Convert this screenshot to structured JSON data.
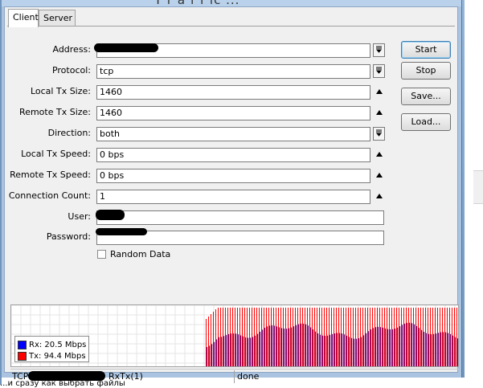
{
  "window": {
    "title_fragment": "T r a f f ic   ..."
  },
  "tabs": [
    {
      "label": "Client",
      "active": true
    },
    {
      "label": "Server",
      "active": false
    }
  ],
  "form": {
    "address": {
      "label": "Address:",
      "value": ""
    },
    "protocol": {
      "label": "Protocol:",
      "value": "tcp"
    },
    "local_tx_size": {
      "label": "Local Tx Size:",
      "value": "1460"
    },
    "remote_tx_size": {
      "label": "Remote Tx Size:",
      "value": "1460"
    },
    "direction": {
      "label": "Direction:",
      "value": "both"
    },
    "local_tx_speed": {
      "label": "Local Tx Speed:",
      "value": "0 bps"
    },
    "remote_tx_speed": {
      "label": "Remote Tx Speed:",
      "value": "0 bps"
    },
    "connection_count": {
      "label": "Connection Count:",
      "value": "1"
    },
    "user": {
      "label": "User:",
      "value": ""
    },
    "password": {
      "label": "Password:",
      "value": ""
    },
    "random_data": {
      "label": "Random Data",
      "checked": false
    }
  },
  "buttons": {
    "start": "Start",
    "stop": "Stop",
    "save": "Save...",
    "load": "Load..."
  },
  "legend": {
    "rx": {
      "label": "Rx: 20.5 Mbps",
      "color": "#0000ff"
    },
    "tx": {
      "label": "Tx: 94.4 Mbps",
      "color": "#ff0000"
    }
  },
  "status": {
    "connection": "TCP",
    "direction_suffix": "RxTx(1)",
    "state": "done"
  },
  "below_window_text": "...и сразу как выбрать файлы"
}
